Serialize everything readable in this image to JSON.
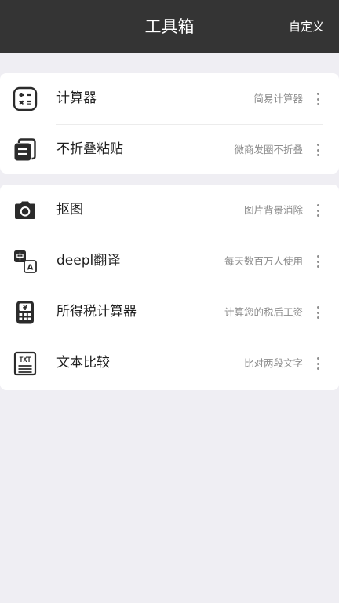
{
  "header": {
    "title": "工具箱",
    "action_label": "自定义",
    "background": "#343434"
  },
  "groups": [
    {
      "items": [
        {
          "icon": "calculator-icon",
          "label": "计算器",
          "desc": "简易计算器"
        },
        {
          "icon": "stacked-cards-icon",
          "label": "不折叠粘贴",
          "desc": "微商发圈不折叠"
        }
      ]
    },
    {
      "items": [
        {
          "icon": "camera-icon",
          "label": "抠图",
          "desc": "图片背景消除"
        },
        {
          "icon": "translate-icon",
          "label": "deepl翻译",
          "desc": "每天数百万人使用"
        },
        {
          "icon": "tax-calculator-icon",
          "label": "所得税计算器",
          "desc": "计算您的税后工资"
        },
        {
          "icon": "txt-document-icon",
          "label": "文本比较",
          "desc": "比对两段文字"
        }
      ]
    }
  ],
  "colors": {
    "background": "#efeef3",
    "card": "#ffffff",
    "text": "#1f1f1f",
    "secondary_text": "#8c8c8c",
    "icon": "#2b2b2b"
  }
}
